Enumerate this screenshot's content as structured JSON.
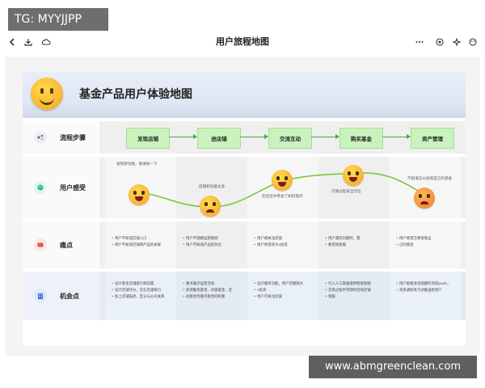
{
  "badge": "TG: MYYJJPP",
  "toolbar": {
    "back_icon": "chevron-left-icon",
    "download_icon": "download-icon",
    "cloud_icon": "cloud-icon",
    "title": "用户旅程地图",
    "more_icon": "more-icon",
    "record_icon": "record-icon",
    "ai_icon": "sparkle-icon",
    "theme_icon": "palette-icon"
  },
  "banner": {
    "title": "基金产品用户体验地图"
  },
  "rows": {
    "flow": {
      "label": "流程步骤"
    },
    "feeling": {
      "label": "用户感受"
    },
    "pain": {
      "label": "痛点"
    },
    "opportunity": {
      "label": "机会点"
    }
  },
  "steps": [
    "发现店铺",
    "进店铺",
    "交流互动",
    "购买基金",
    "资产管理"
  ],
  "feelings": [
    "发现新功能，看请按一下",
    "店铺和功能太多",
    "在社区中参会了如何操作",
    "交易过程安全可信",
    "不知道怎么找到自己的基金"
  ],
  "pain_points": [
    [
      "用户不知道店铺入口",
      "用户不知道店铺和产品的关联"
    ],
    [
      "用户不理解运营规则",
      "用户不知道产品的优劣"
    ],
    [
      "用户想关注店铺",
      "用户希望获大v投资"
    ],
    [
      "用户遇到问题时，需",
      "要咨询客服"
    ],
    [
      "用户希望方便查看自",
      "己的基金"
    ]
  ],
  "opportunities": [
    [
      "设计基金店铺排行榜前置",
      "设计店铺评分，且在店铺排行",
      "加上店铺描述，区分与公司关系"
    ],
    [
      "重点展示运营活动",
      "获得推荐基金、优质基金、走",
      "动基金等重点基金的权重"
    ],
    [
      "设计服务功能，用户可跟随大",
      "v投资",
      "用户可关注店铺"
    ],
    [
      "引入人工客服提供智能客服",
      "交易过程中可随时咨询店铺",
      "客服"
    ],
    [
      "用户能看会话提醒的消息push，",
      "消息通知等方式推送给用户"
    ]
  ],
  "watermark": "www.abmgreenclean.com"
}
